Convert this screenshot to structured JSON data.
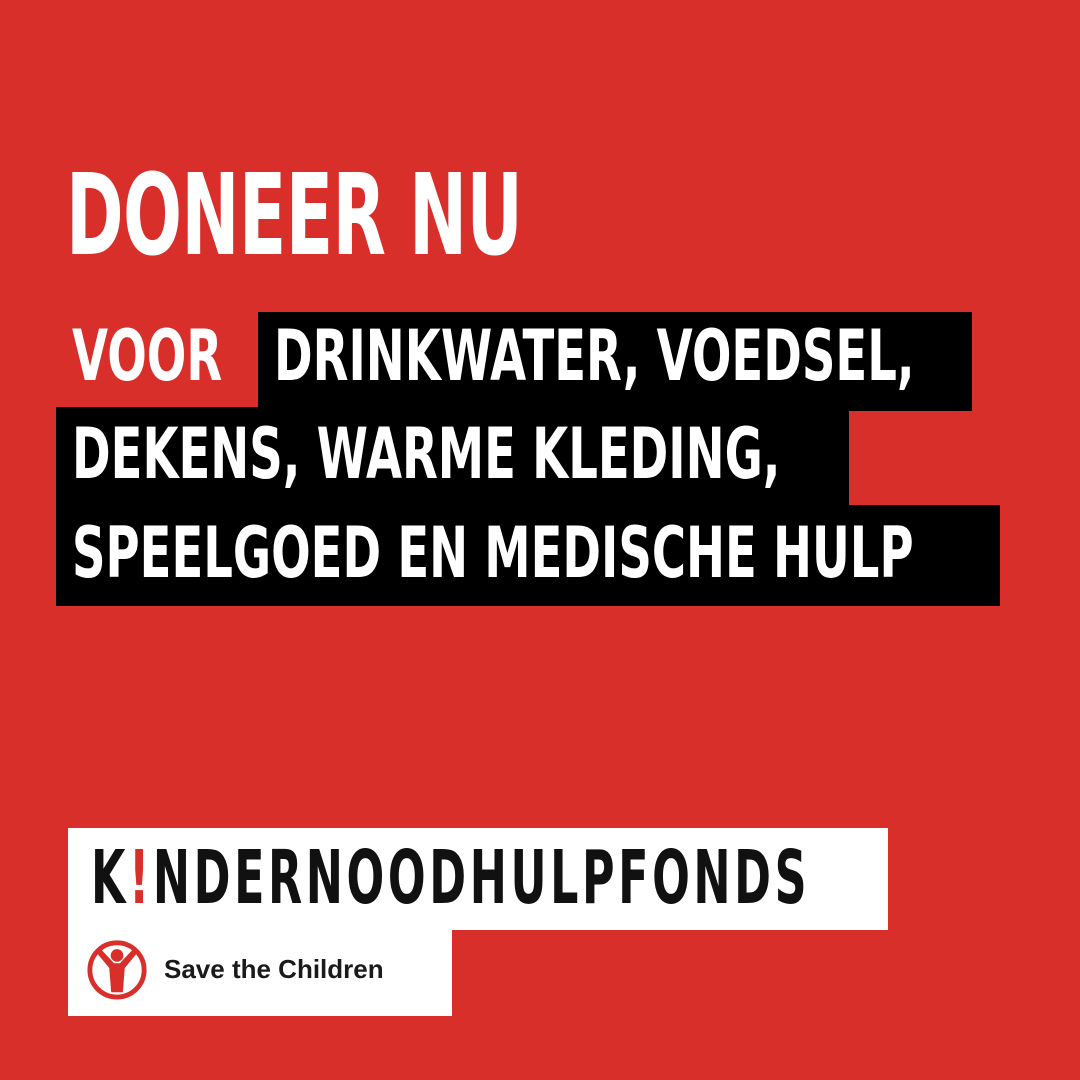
{
  "poster": {
    "headline": "DONEER NU",
    "body": {
      "prefix": "VOOR",
      "highlighted_lines": [
        "DRINKWATER, VOEDSEL,",
        "DEKENS, WARME KLEDING,",
        "SPEELGOED EN MEDISCHE HULP"
      ]
    },
    "logo": {
      "wordmark_k": "K",
      "wordmark_bang": "!",
      "wordmark_rest": "NDERNOODHULPFONDS",
      "partner_name": "Save the Children",
      "partner_icon": "save-the-children-logo-icon"
    },
    "colors": {
      "background": "#d92f2a",
      "highlight": "#000000",
      "text": "#ffffff",
      "logo_box": "#ffffff"
    }
  }
}
